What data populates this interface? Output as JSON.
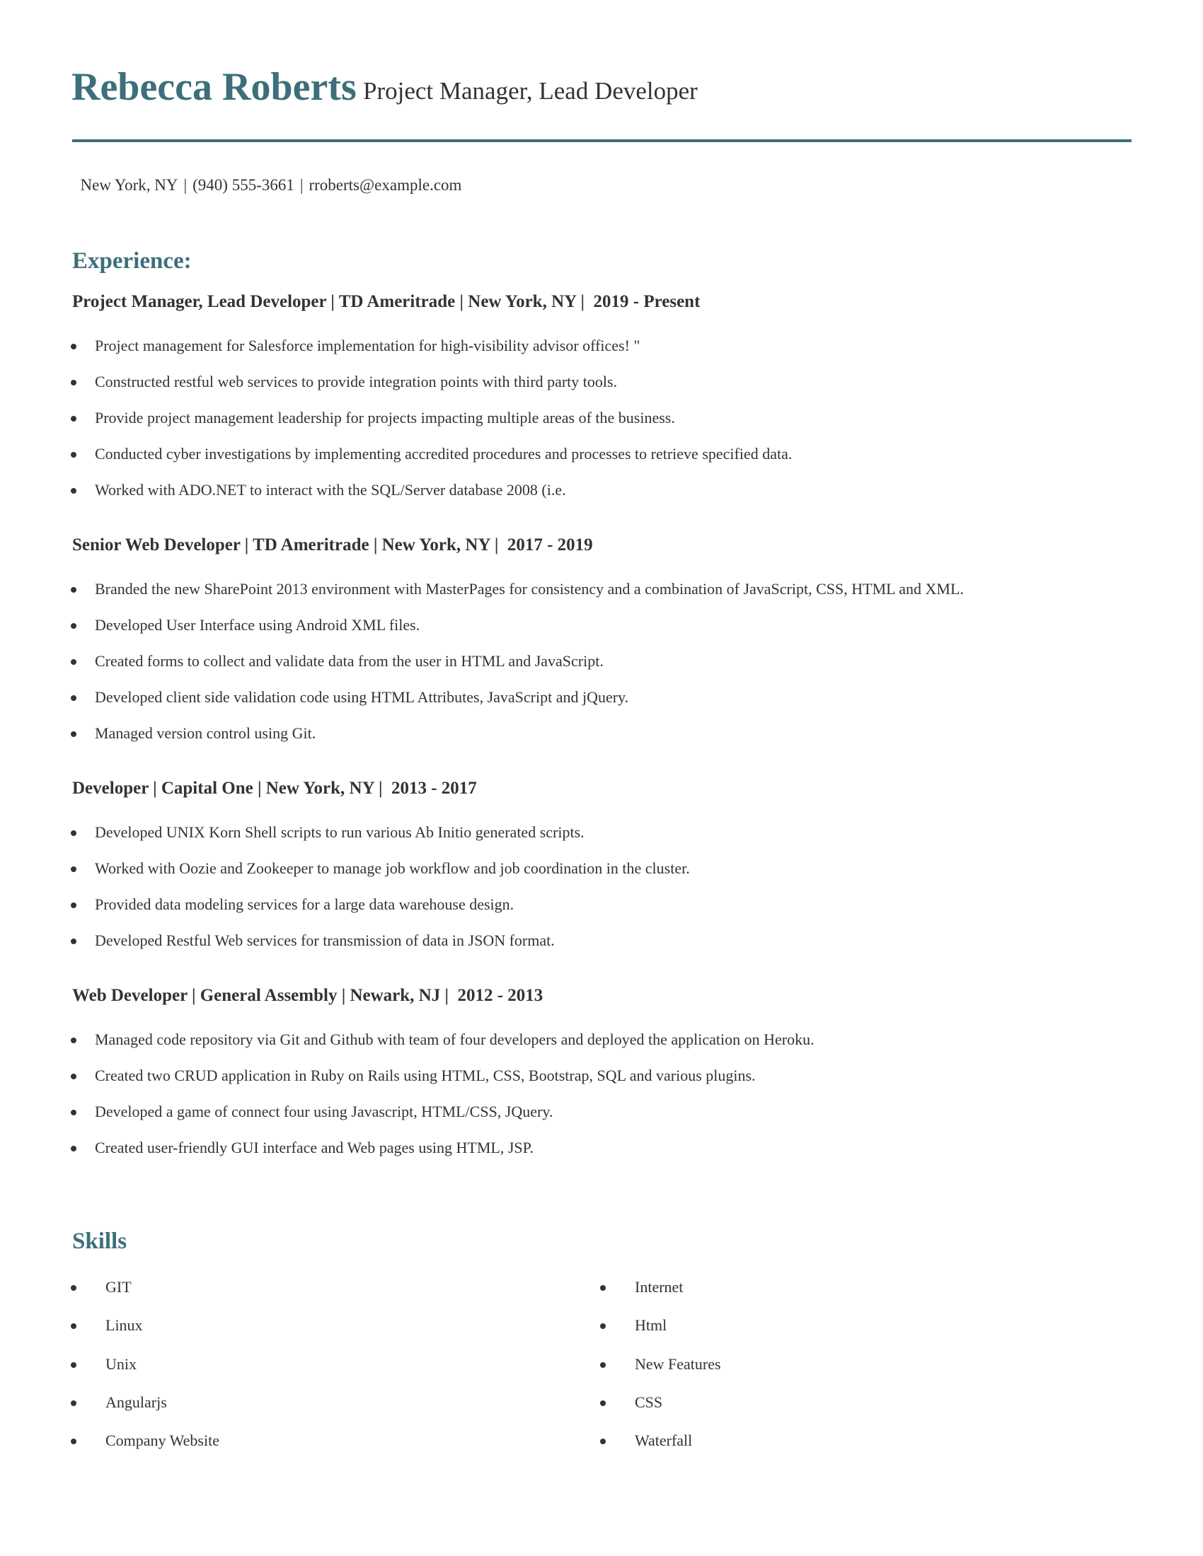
{
  "header": {
    "name": "Rebecca Roberts",
    "title": "Project Manager, Lead Developer",
    "contact": {
      "location": "New York, NY",
      "phone": "(940) 555-3661",
      "email": "rroberts@example.com",
      "separator": "|"
    }
  },
  "colors": {
    "accent": "#3d6f7a",
    "text": "#333333"
  },
  "experience": {
    "heading": "Experience:",
    "jobs": [
      {
        "title_line": "Project Manager, Lead Developer | TD Ameritrade | New York, NY |  2019 - Present",
        "bullets": [
          "Project management for Salesforce implementation for high-visibility advisor offices! \"",
          "Constructed restful web services to provide integration points with third party tools.",
          "Provide project management leadership for projects impacting multiple areas of the business.",
          "Conducted cyber investigations by implementing accredited procedures and processes to retrieve specified data.",
          "Worked with ADO.NET to interact with the SQL/Server database 2008 (i.e."
        ]
      },
      {
        "title_line": "Senior Web Developer | TD Ameritrade | New York, NY |  2017 - 2019",
        "bullets": [
          "Branded the new SharePoint 2013 environment with MasterPages for consistency and a combination of JavaScript, CSS, HTML and XML.",
          "Developed User Interface using Android XML files.",
          "Created forms to collect and validate data from the user in HTML and JavaScript.",
          "Developed client side validation code using HTML Attributes, JavaScript and jQuery.",
          "Managed version control using Git."
        ]
      },
      {
        "title_line": "Developer | Capital One | New York, NY |  2013 - 2017",
        "bullets": [
          "Developed UNIX Korn Shell scripts to run various Ab Initio generated scripts.",
          "Worked with Oozie and Zookeeper to manage job workflow and job coordination in the cluster.",
          "Provided data modeling services for a large data warehouse design.",
          "Developed Restful Web services for transmission of data in JSON format."
        ]
      },
      {
        "title_line": "Web Developer | General Assembly | Newark, NJ |  2012 - 2013",
        "bullets": [
          "Managed code repository via Git and Github with team of four developers and deployed the application on Heroku.",
          "Created two CRUD application in Ruby on Rails using HTML, CSS, Bootstrap, SQL and various plugins.",
          "Developed a game of connect four using Javascript, HTML/CSS, JQuery.",
          "Created user-friendly GUI interface and Web pages using HTML, JSP."
        ]
      }
    ]
  },
  "skills": {
    "heading": "Skills",
    "left": [
      "GIT",
      "Linux",
      "Unix",
      "Angularjs",
      "Company Website"
    ],
    "right": [
      "Internet",
      "Html",
      "New Features",
      "CSS",
      "Waterfall"
    ]
  }
}
